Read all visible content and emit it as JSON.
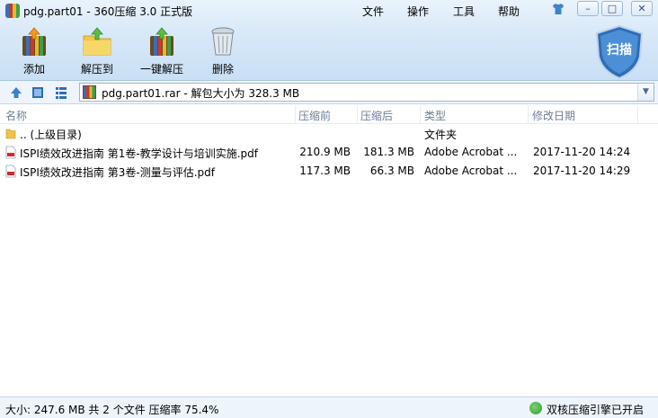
{
  "window": {
    "title": "pdg.part01 - 360压缩 3.0 正式版",
    "menu": [
      {
        "label": "文件"
      },
      {
        "label": "操作"
      },
      {
        "label": "工具"
      },
      {
        "label": "帮助"
      }
    ],
    "controls": {
      "minimize": "–",
      "maximize": "□",
      "close": "✕"
    }
  },
  "toolbar": {
    "buttons": [
      {
        "label": "添加",
        "icon": "add-archive-icon"
      },
      {
        "label": "解压到",
        "icon": "extract-to-icon"
      },
      {
        "label": "一键解压",
        "icon": "one-click-extract-icon"
      },
      {
        "label": "删除",
        "icon": "delete-trash-icon"
      }
    ],
    "scan_label": "扫描"
  },
  "address": {
    "path": "pdg.part01.rar - 解包大小为 328.3 MB"
  },
  "list": {
    "columns": [
      "名称",
      "压缩前",
      "压缩后",
      "类型",
      "修改日期"
    ],
    "rows": [
      {
        "icon": "folder-icon",
        "name": ".. (上级目录)",
        "original": "",
        "compressed": "",
        "type": "文件夹",
        "modified": ""
      },
      {
        "icon": "pdf-icon",
        "name": "ISPI绩效改进指南 第1卷-教学设计与培训实施.pdf",
        "original": "210.9 MB",
        "compressed": "181.3 MB",
        "type": "Adobe Acrobat ...",
        "modified": "2017-11-20 14:24"
      },
      {
        "icon": "pdf-icon",
        "name": "ISPI绩效改进指南 第3卷-测量与评估.pdf",
        "original": "117.3 MB",
        "compressed": "66.3 MB",
        "type": "Adobe Acrobat ...",
        "modified": "2017-11-20 14:29"
      }
    ]
  },
  "status": {
    "summary": "大小: 247.6 MB 共 2 个文件 压缩率 75.4%",
    "engine": "双核压缩引擎已开启"
  },
  "colors": {
    "chrome_top": "#e9f3fc",
    "chrome_bottom": "#c9dff4",
    "accent": "#2f6db5",
    "header_text": "#6d7f94"
  }
}
